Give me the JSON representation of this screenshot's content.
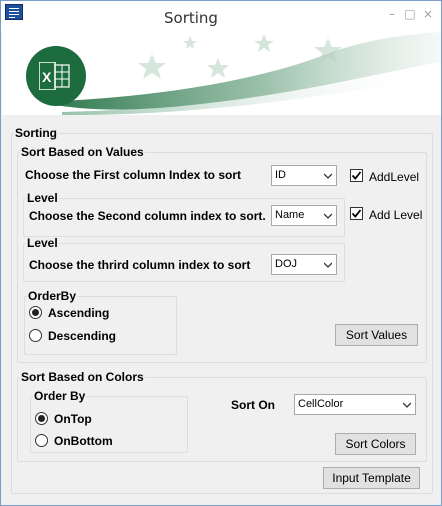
{
  "window": {
    "title": "Sorting",
    "app_icon": "form-icon",
    "controls": {
      "minimize": "–",
      "maximize": "□",
      "close": "×"
    }
  },
  "banner": {
    "logo": "excel-icon",
    "accent_color": "#1d6c3f"
  },
  "sorting": {
    "legend": "Sorting",
    "values": {
      "legend": "Sort Based on Values",
      "first_label": "Choose the First column Index to sort",
      "first_value": "ID",
      "addlevel_1_label": "AddLevel",
      "addlevel_1_checked": true,
      "level2_legend": "Level",
      "second_label": "Choose the Second column index to sort.",
      "second_value": "Name",
      "addlevel_2_label": "Add Level",
      "addlevel_2_checked": true,
      "level3_legend": "Level",
      "third_label": "Choose the thrird column index to sort",
      "third_value": "DOJ",
      "orderby_legend": "OrderBy",
      "ascending_label": "Ascending",
      "descending_label": "Descending",
      "selected_order": "Ascending",
      "sort_button": "Sort Values"
    },
    "colors": {
      "legend": "Sort Based on Colors",
      "orderby_legend": "Order By",
      "ontop_label": "OnTop",
      "onbottom_label": "OnBottom",
      "selected_order": "OnTop",
      "sort_on_label": "Sort On",
      "sort_on_value": "CellColor",
      "sort_button": "Sort Colors"
    },
    "input_template_button": "Input Template"
  }
}
